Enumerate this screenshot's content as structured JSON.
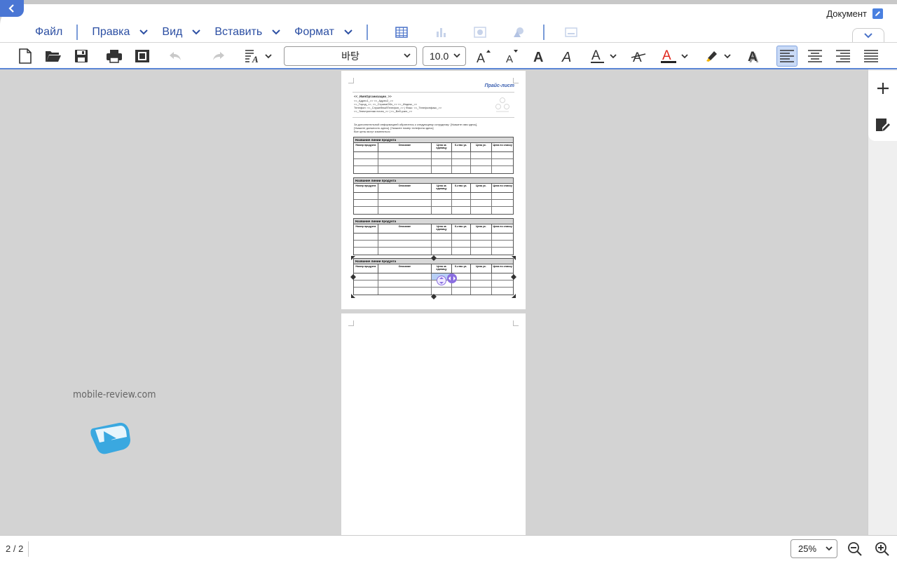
{
  "app": {
    "mode_label": "Документ"
  },
  "menubar": {
    "items": [
      {
        "label": "Файл"
      },
      {
        "label": "Правка"
      },
      {
        "label": "Вид"
      },
      {
        "label": "Вставить"
      },
      {
        "label": "Формат"
      }
    ],
    "insert_icons": [
      "table-icon",
      "chart-icon",
      "image-icon",
      "shape-icon",
      "textbox-icon"
    ]
  },
  "toolbar": {
    "font_name": "바탕",
    "font_size": "10.0",
    "icons": [
      "new-document-icon",
      "open-folder-icon",
      "save-icon",
      "print-icon",
      "print-preview-icon",
      "undo-icon",
      "redo-icon",
      "text-style-icon",
      "font-size-increase-icon",
      "font-size-decrease-icon",
      "bold-icon",
      "italic-icon",
      "underline-icon",
      "strikethrough-icon",
      "font-color-icon",
      "highlight-icon",
      "text-shadow-icon",
      "align-left-icon",
      "align-center-icon",
      "align-right-icon",
      "justify-icon"
    ],
    "colors": {
      "font_color": "#e0281e",
      "highlight": "#f5b400",
      "accent": "#2c4fa3"
    }
  },
  "document": {
    "title": "Прайс-лист",
    "org_lines": [
      "<<_ИмяОрганизации_>>",
      "<<_Адрес1_>> <<_Адрес2_>>",
      "<<_Город_>>, <<_СтранаОбл_>> <<_Индекс_>>",
      "Телефон: <<_СлужебныйТелефон_>> | Факс: <<_Телефонфакс_>>",
      "<<_Электронная почта_>> | <<_Веб-узел_>>"
    ],
    "info_lines": [
      "За дополнительной информацией обратитесь к следующему сотруднику: [Укажите имя здесь],",
      "[Укажите должность здесь]. [Укажите номер телефона здесь]",
      "Все цены могут изменяться"
    ],
    "table_header": "Название линии продукта",
    "columns": [
      "Номер продукта",
      "Описание",
      "Цена за единицу",
      "К-ство ук.",
      "Цена ук.",
      "Цена по списку"
    ]
  },
  "status": {
    "page_indicator": "2 / 2",
    "zoom": "25%"
  },
  "watermark": {
    "text": "mobile-review.com"
  }
}
